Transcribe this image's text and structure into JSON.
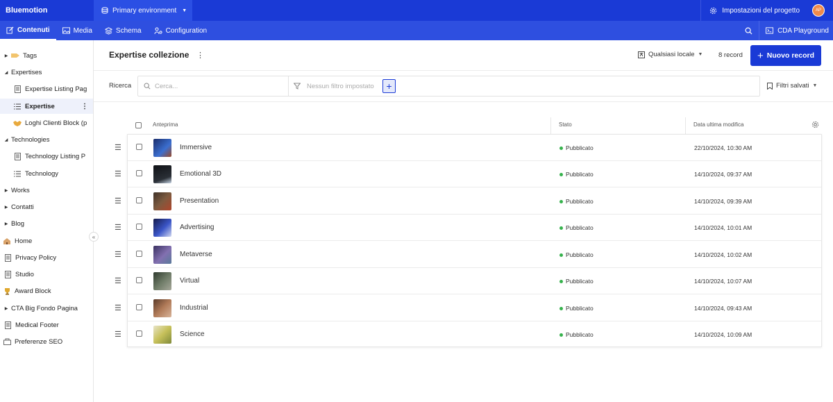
{
  "app": {
    "brand": "Bluemotion",
    "environment": "Primary environment",
    "settings_label": "Impostazioni del progetto",
    "avatar_initials": "AP",
    "accent": "#1a3ad6"
  },
  "nav": {
    "items": [
      {
        "label": "Contenuti",
        "icon": "edit-icon",
        "active": true
      },
      {
        "label": "Media",
        "icon": "image-icon"
      },
      {
        "label": "Schema",
        "icon": "layers-icon"
      },
      {
        "label": "Configuration",
        "icon": "config-icon"
      }
    ],
    "cda_label": "CDA Playground"
  },
  "sidebar": {
    "items": [
      {
        "label": "Tags",
        "icon": "tag-icon",
        "expander": "▶"
      },
      {
        "label": "Expertises",
        "icon": "",
        "expander": "◢"
      },
      {
        "label": "Expertise Listing Pag",
        "icon": "page-icon",
        "indent": true
      },
      {
        "label": "Expertise",
        "icon": "list-icon",
        "indent": true,
        "selected": true
      },
      {
        "label": "Loghi Clienti Block (p",
        "icon": "handshake-icon",
        "indent": true
      },
      {
        "label": "Technologies",
        "icon": "",
        "expander": "◢"
      },
      {
        "label": "Technology Listing P",
        "icon": "page-icon",
        "indent": true
      },
      {
        "label": "Technology",
        "icon": "list-icon",
        "indent": true
      },
      {
        "label": "Works",
        "icon": "",
        "expander": "▶"
      },
      {
        "label": "Contatti",
        "icon": "",
        "expander": "▶"
      },
      {
        "label": "Blog",
        "icon": "",
        "expander": "▶"
      },
      {
        "label": "Home",
        "icon": "house-icon"
      },
      {
        "label": "Privacy Policy",
        "icon": "page-icon"
      },
      {
        "label": "Studio",
        "icon": "page-icon"
      },
      {
        "label": "Award Block",
        "icon": "trophy-icon"
      },
      {
        "label": "CTA Big Fondo Pagina",
        "icon": "",
        "expander": "▶"
      },
      {
        "label": "Medical Footer",
        "icon": "page-icon"
      },
      {
        "label": "Preferenze SEO",
        "icon": "seo-icon"
      }
    ]
  },
  "main": {
    "title": "Expertise collezione",
    "locale": "Qualsiasi locale",
    "record_count": "8 record",
    "new_button": "Nuovo record",
    "search_label": "Ricerca",
    "search_placeholder": "Cerca...",
    "filter_placeholder": "Nessun filtro impostato",
    "saved_filters": "Filtri salvati"
  },
  "table": {
    "columns": {
      "preview": "Anteprima",
      "status": "Stato",
      "modified": "Data ultima modifica"
    },
    "rows": [
      {
        "name": "Immersive",
        "status": "Pubblicato",
        "date": "22/10/2024, 10:30 AM",
        "thumb": "#2a4f9c"
      },
      {
        "name": "Emotional 3D",
        "status": "Pubblicato",
        "date": "14/10/2024, 09:37 AM",
        "thumb": "#1b1f24"
      },
      {
        "name": "Presentation",
        "status": "Pubblicato",
        "date": "14/10/2024, 09:39 AM",
        "thumb": "#5b4a3a"
      },
      {
        "name": "Advertising",
        "status": "Pubblicato",
        "date": "14/10/2024, 10:01 AM",
        "thumb": "#2c3b8a"
      },
      {
        "name": "Metaverse",
        "status": "Pubblicato",
        "date": "14/10/2024, 10:02 AM",
        "thumb": "#6a5c8c"
      },
      {
        "name": "Virtual",
        "status": "Pubblicato",
        "date": "14/10/2024, 10:07 AM",
        "thumb": "#4d5a4c"
      },
      {
        "name": "Industrial",
        "status": "Pubblicato",
        "date": "14/10/2024, 09:43 AM",
        "thumb": "#8a5a44"
      },
      {
        "name": "Science",
        "status": "Pubblicato",
        "date": "14/10/2024, 10:09 AM",
        "thumb": "#b8b34a"
      }
    ],
    "status_color": "#37b24d"
  }
}
